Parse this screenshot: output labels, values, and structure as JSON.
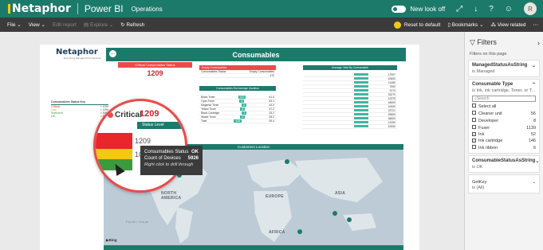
{
  "topbar": {
    "logo": "Netaphor",
    "product": "Power BI",
    "workspace": "Operations",
    "new_look": "New look off",
    "avatar": "R"
  },
  "actionbar": {
    "file": "File",
    "view": "View",
    "edit_report": "Edit report",
    "explore": "Explore",
    "refresh": "Refresh",
    "reset": "Reset to default",
    "bookmarks": "Bookmarks",
    "view_related": "View related"
  },
  "report": {
    "logo_name": "Netaphor",
    "logo_tag": "Everything Managed Print Services",
    "title": "Consumables",
    "legend": {
      "title": "Consumables Status Key",
      "rows": [
        {
          "status": "Critical",
          "level": "< 10%"
        },
        {
          "status": "Low",
          "level": "< 19%"
        },
        {
          "status": "Sufficient",
          "level": "< 50%"
        },
        {
          "status": "OK",
          "level": "> 50%"
        }
      ]
    },
    "critical_card": {
      "title": "Critical Consumables Status",
      "value": "1209"
    },
    "empty_card": {
      "title": "Empty Consumables",
      "col1": "Consumables Status",
      "col2": "Empty Consumables",
      "value": "470"
    },
    "avg_days": {
      "title": "Consumables Est Average Duration",
      "rows": [
        {
          "desc": "Black Toner",
          "v1": "147",
          "v2": "61.0"
        },
        {
          "desc": "Cyan Toner",
          "v1": "4",
          "v2": "53.1"
        },
        {
          "desc": "Magenta Toner",
          "v1": "4",
          "v2": "44.0"
        },
        {
          "desc": "Yellow Toner",
          "v1": "4",
          "v2": "47.2"
        },
        {
          "desc": "Black Cartridge",
          "v1": "7",
          "v2": "33.2"
        },
        {
          "desc": "Waste Toner",
          "v1": "2",
          "v2": "25.0"
        },
        {
          "desc": "Total",
          "v1": "415",
          "v2": "39.4"
        }
      ]
    },
    "avg_yield": {
      "title": "Average Yield By Consumable",
      "rows": [
        "17997",
        "10600",
        "11450",
        "7500",
        "3174",
        "33270",
        "12375",
        "18000",
        "10000",
        "23721",
        "25500",
        "36500",
        "12250",
        "10000"
      ]
    },
    "customers_location": "Customers Location",
    "map_labels": {
      "na": "NORTH AMERICA",
      "eu": "EUROPE",
      "asia": "ASIA",
      "africa": "AFRICA",
      "pacific": "Pacific Ocean",
      "bing": "Bing"
    }
  },
  "magnifier": {
    "critical_label": "Critical",
    "big_value": "1209",
    "header": "Status Level",
    "value_1": "1209",
    "value_2": "1030"
  },
  "tooltip": {
    "status_label": "Consumables Status",
    "status_value": "OK",
    "count_label": "Count of Devices",
    "count_value": "5926",
    "hint": "Right click to drill through"
  },
  "filters": {
    "title": "Filters",
    "sub": "Filters on this page",
    "managed": {
      "title": "ManagedStatusAsString",
      "value": "is Managed"
    },
    "type": {
      "title": "Consumable Type",
      "value": "is Ink, ink cartridge, Toner, or T...",
      "search": "Search",
      "options": [
        {
          "label": "Select all",
          "count": "",
          "checked": false
        },
        {
          "label": "Cleaner unit",
          "count": "56",
          "checked": false
        },
        {
          "label": "Developer",
          "count": "8",
          "checked": false
        },
        {
          "label": "Fuser",
          "count": "1139",
          "checked": false
        },
        {
          "label": "Ink",
          "count": "52",
          "checked": true
        },
        {
          "label": "Ink cartridge",
          "count": "146",
          "checked": true
        },
        {
          "label": "Ink ribbon",
          "count": "6",
          "checked": false
        }
      ]
    },
    "status": {
      "title": "ConsumableStatusAsString",
      "value": "is OK"
    },
    "getkey": {
      "title": "GetKey",
      "value": "is (All)"
    }
  },
  "colors": {
    "brand": "#1c7a6b",
    "critical": "#e8262b",
    "low": "#f2c811",
    "ok": "#3c9a3c"
  }
}
